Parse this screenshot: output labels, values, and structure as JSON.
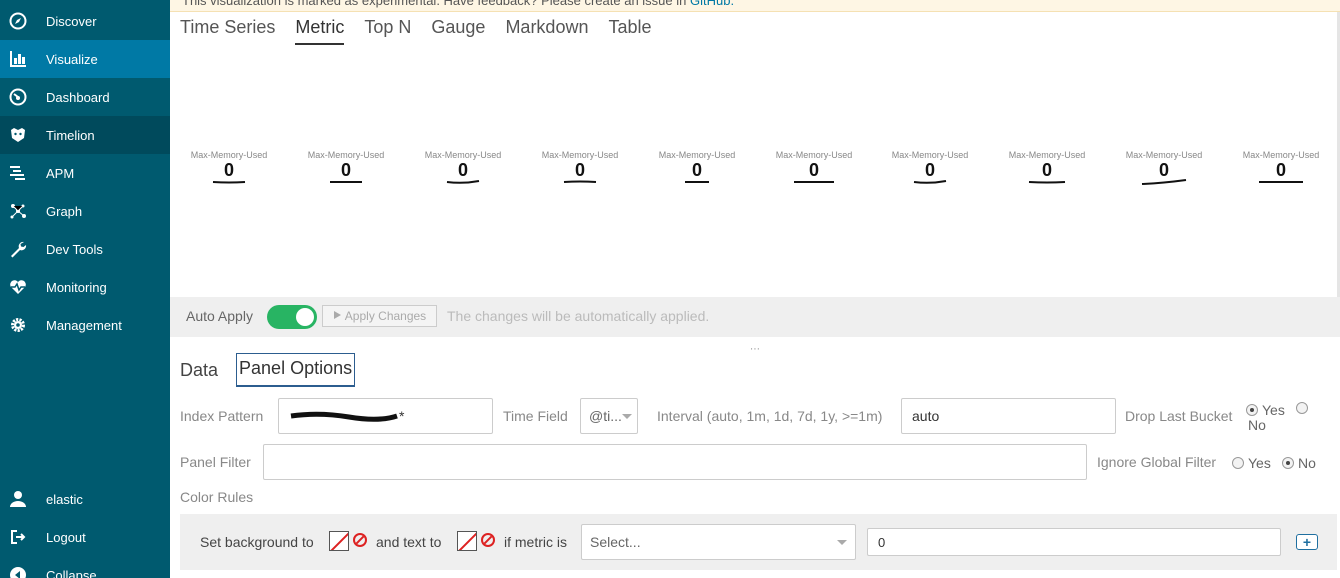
{
  "banner": {
    "text_prefix": "This visualization is marked as experimental. Have feedback? Please create an issue in ",
    "link": "GitHub."
  },
  "sidebar": {
    "items": [
      {
        "label": "Discover",
        "icon": "compass-icon",
        "state": "normal"
      },
      {
        "label": "Visualize",
        "icon": "bar-chart-icon",
        "state": "active"
      },
      {
        "label": "Dashboard",
        "icon": "dashboard-icon",
        "state": "normal"
      },
      {
        "label": "Timelion",
        "icon": "timelion-icon",
        "state": "dark"
      },
      {
        "label": "APM",
        "icon": "apm-icon",
        "state": "normal"
      },
      {
        "label": "Graph",
        "icon": "graph-icon",
        "state": "normal"
      },
      {
        "label": "Dev Tools",
        "icon": "wrench-icon",
        "state": "normal"
      },
      {
        "label": "Monitoring",
        "icon": "heartbeat-icon",
        "state": "normal"
      },
      {
        "label": "Management",
        "icon": "gear-icon",
        "state": "normal"
      }
    ],
    "user": {
      "label": "elastic",
      "icon": "user-icon"
    },
    "logout": {
      "label": "Logout",
      "icon": "logout-icon"
    },
    "collapse": {
      "label": "Collapse",
      "icon": "collapse-icon"
    }
  },
  "tabs": [
    "Time Series",
    "Metric",
    "Top N",
    "Gauge",
    "Markdown",
    "Table"
  ],
  "active_tab": "Metric",
  "metrics": [
    {
      "label": "Max-Memory-Used",
      "value": "0"
    },
    {
      "label": "Max-Memory-Used",
      "value": "0"
    },
    {
      "label": "Max-Memory-Used",
      "value": "0"
    },
    {
      "label": "Max-Memory-Used",
      "value": "0"
    },
    {
      "label": "Max-Memory-Used",
      "value": "0"
    },
    {
      "label": "Max-Memory-Used",
      "value": "0"
    },
    {
      "label": "Max-Memory-Used",
      "value": "0"
    },
    {
      "label": "Max-Memory-Used",
      "value": "0"
    },
    {
      "label": "Max-Memory-Used",
      "value": "0"
    },
    {
      "label": "Max-Memory-Used",
      "value": "0"
    }
  ],
  "apply_bar": {
    "auto_apply_label": "Auto Apply",
    "auto_apply_on": true,
    "apply_button": "Apply Changes",
    "message": "The changes will be automatically applied."
  },
  "subtabs": [
    "Data",
    "Panel Options"
  ],
  "active_subtab": "Panel Options",
  "panel_options": {
    "index_pattern_label": "Index Pattern",
    "index_pattern_value": "*",
    "time_field_label": "Time Field",
    "time_field_value": "@ti...",
    "interval_label": "Interval (auto, 1m, 1d, 7d, 1y, >=1m)",
    "interval_value": "auto",
    "drop_last_bucket_label": "Drop Last Bucket",
    "yes": "Yes",
    "no": "No",
    "drop_last_bucket_value": "Yes",
    "panel_filter_label": "Panel Filter",
    "panel_filter_value": "",
    "ignore_global_filter_label": "Ignore Global Filter",
    "ignore_global_filter_value": "No",
    "color_rules_label": "Color Rules"
  },
  "color_rule": {
    "set_bg": "Set background to",
    "and_text": "and text to",
    "if_metric": "if metric is",
    "select_placeholder": "Select...",
    "value": "0",
    "add": "+"
  },
  "colors": {
    "sidebar": "#005a6f",
    "sidebar_active": "#0079a5",
    "toggle_on": "#28b463"
  }
}
